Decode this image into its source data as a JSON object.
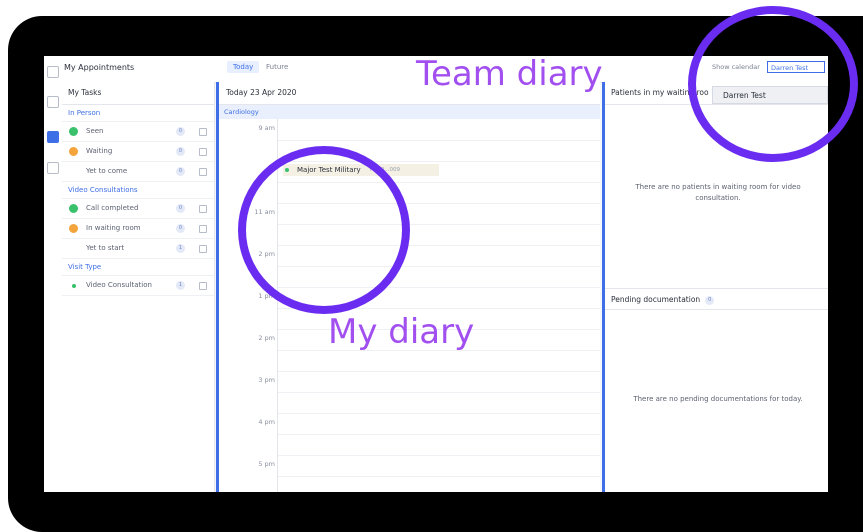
{
  "header": {
    "title": "My Appointments",
    "tab_today": "Today",
    "tab_future": "Future",
    "show_calendar_label": "Show calendar",
    "calendar_value": "Darren Test"
  },
  "dropdown": {
    "option": "Darren Test"
  },
  "tasks": {
    "heading": "My Tasks",
    "in_person": {
      "label": "In Person",
      "items": [
        {
          "label": "Seen",
          "count": "0"
        },
        {
          "label": "Waiting",
          "count": "0"
        },
        {
          "label": "Yet to come",
          "count": "0"
        }
      ]
    },
    "video": {
      "label": "Video Consultations",
      "items": [
        {
          "label": "Call completed",
          "count": "0"
        },
        {
          "label": "In waiting room",
          "count": "0"
        },
        {
          "label": "Yet to start",
          "count": "1"
        }
      ]
    },
    "visit_type": {
      "label": "Visit Type",
      "items": [
        {
          "label": "Video Consultation",
          "count": "1"
        }
      ]
    }
  },
  "diary": {
    "date": "Today 23 Apr 2020",
    "category": "Cardiology",
    "times": [
      "9 am",
      "10",
      "11 am",
      "2 pm",
      "1 pm",
      "2 pm",
      "3 pm",
      "4 pm",
      "5 pm"
    ],
    "appointment": {
      "name": "Major Test Military",
      "id": "HF10...009"
    }
  },
  "right": {
    "waiting_heading": "Patients in my waiting roo",
    "waiting_message": "There are no patients in waiting room for video consultation.",
    "pending_heading": "Pending documentation",
    "pending_count": "0",
    "pending_message": "There are no pending documentations for today."
  },
  "annotations": {
    "team": "Team diary",
    "mine": "My diary"
  },
  "colors": {
    "accent": "#3f6fe6",
    "annotation_text": "#a24ff0",
    "annotation_circle": "#6a2cf0",
    "frame": "#000000"
  }
}
